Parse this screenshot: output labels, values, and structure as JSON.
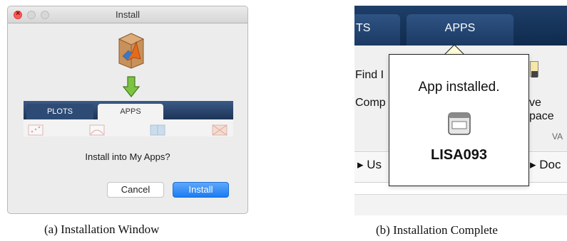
{
  "install_window": {
    "title": "Install",
    "toolstrip": {
      "tabs": [
        {
          "label": "PLOTS",
          "active": false
        },
        {
          "label": "APPS",
          "active": true
        }
      ]
    },
    "prompt": "Install into My Apps?",
    "buttons": {
      "cancel_label": "Cancel",
      "install_label": "Install"
    },
    "caption": "(a) Installation Window"
  },
  "complete_view": {
    "tabs": [
      {
        "label": "TS"
      },
      {
        "label": "APPS"
      }
    ],
    "ribbon_fragments": {
      "find": "Find I",
      "comp": "Comp",
      "ve": "ve",
      "pace": "pace",
      "va": "VA"
    },
    "path_fragments": {
      "left": "▸ Us",
      "right": "▸ Doc"
    },
    "popup": {
      "message": "App installed.",
      "app_name": "LISA093",
      "icon": "app-window-icon"
    },
    "caption": "(b) Installation Complete"
  },
  "colors": {
    "toolstrip_blue": "#1d3457",
    "install_button": "#1b7cf2",
    "close_button": "#fc5b57",
    "arrow_green": "#7dc242"
  }
}
